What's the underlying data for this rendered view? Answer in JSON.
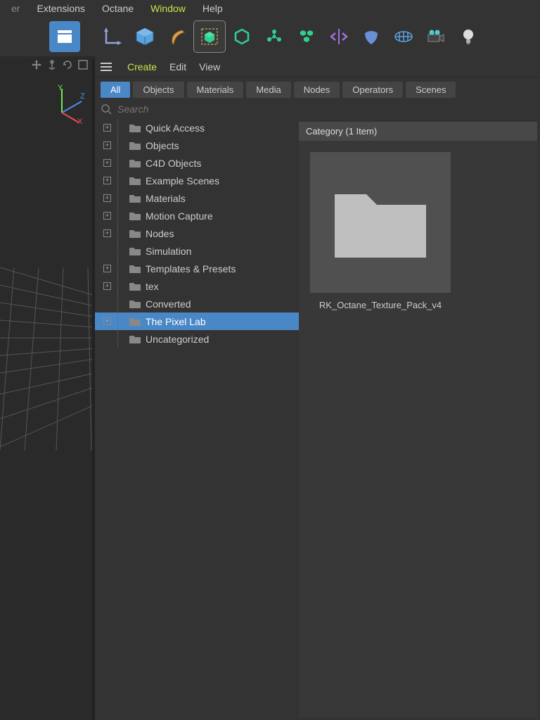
{
  "top_menu": {
    "er": "er",
    "extensions": "Extensions",
    "octane": "Octane",
    "window": "Window",
    "help": "Help"
  },
  "panel_menu": {
    "create": "Create",
    "edit": "Edit",
    "view": "View"
  },
  "filter_tabs": {
    "all": "All",
    "objects": "Objects",
    "materials": "Materials",
    "media": "Media",
    "nodes": "Nodes",
    "operators": "Operators",
    "scenes": "Scenes"
  },
  "search": {
    "placeholder": "Search"
  },
  "tree": {
    "items": [
      {
        "label": "Quick Access",
        "expandable": true
      },
      {
        "label": "Objects",
        "expandable": true
      },
      {
        "label": "C4D Objects",
        "expandable": true
      },
      {
        "label": "Example Scenes",
        "expandable": true
      },
      {
        "label": "Materials",
        "expandable": true
      },
      {
        "label": "Motion Capture",
        "expandable": true
      },
      {
        "label": "Nodes",
        "expandable": true
      },
      {
        "label": "Simulation",
        "expandable": false
      },
      {
        "label": "Templates & Presets",
        "expandable": true
      },
      {
        "label": "tex",
        "expandable": true
      },
      {
        "label": "Converted",
        "expandable": false
      },
      {
        "label": "The Pixel Lab",
        "expandable": true,
        "selected": true
      },
      {
        "label": "Uncategorized",
        "expandable": false
      }
    ]
  },
  "category": {
    "header": "Category (1 Item)",
    "item_label": "RK_Octane_Texture_Pack_v4"
  },
  "axis": {
    "x": "X",
    "y": "Y",
    "z": "Z"
  }
}
